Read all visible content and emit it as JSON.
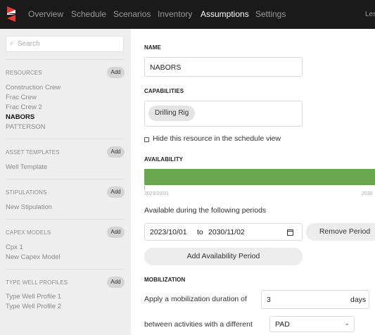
{
  "nav": {
    "items": [
      "Overview",
      "Schedule",
      "Scenarios",
      "Inventory",
      "Assumptions",
      "Settings"
    ],
    "active": "Assumptions",
    "user": "Les"
  },
  "sidebar": {
    "search_placeholder": "Search",
    "sections": [
      {
        "title": "RESOURCES",
        "add_label": "Add",
        "items": [
          "Construction Crew",
          "Frac Crew",
          "Frac Crew 2",
          "NABORS",
          "PATTERSON"
        ],
        "selected": "NABORS"
      },
      {
        "title": "ASSET TEMPLATES",
        "add_label": "Add",
        "items": [
          "Well Template"
        ]
      },
      {
        "title": "STIPULATIONS",
        "add_label": "Add",
        "items": [
          "New Stipulation"
        ]
      },
      {
        "title": "CAPEX MODELS",
        "add_label": "Add",
        "items": [
          "Cpx 1",
          "New Capex Model"
        ]
      },
      {
        "title": "TYPE WELL PROFILES",
        "add_label": "Add",
        "items": [
          "Type Well Profile 1",
          "Type Well Profile 2"
        ]
      }
    ]
  },
  "main": {
    "name_label": "NAME",
    "name_value": "NABORS",
    "capabilities_label": "CAPABILITIES",
    "capabilities": [
      "Drilling Rig"
    ],
    "hide_label": "Hide this resource in the schedule view",
    "hide_checked": false,
    "availability_label": "AVAILABILITY",
    "availability_bar_color": "#6aa84f",
    "timeline_start": "2023/10/01",
    "timeline_end_partial": "2030",
    "periods_text": "Available during the following periods",
    "period": {
      "start": "2023/10/01",
      "to": "to",
      "end": "2030/11/02"
    },
    "remove_period_label": "Remove Period",
    "add_period_label": "Add Availability Period",
    "mobilization_label": "MOBILIZATION",
    "mobilization_text": "Apply a mobilization duration of",
    "mobilization_value": "3",
    "mobilization_unit": "days",
    "between_text": "between activities with a different",
    "between_select": "PAD"
  }
}
